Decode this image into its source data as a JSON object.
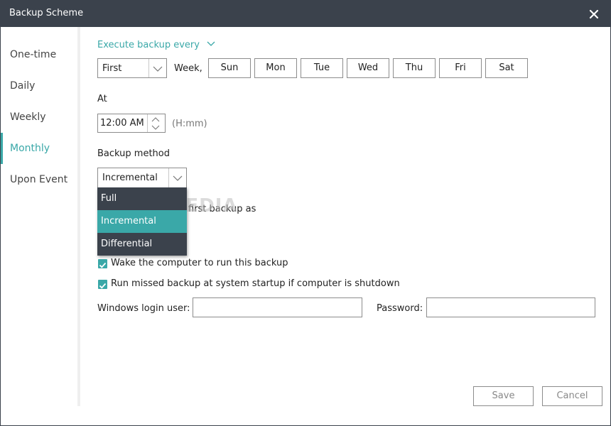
{
  "window": {
    "title": "Backup Scheme"
  },
  "sidebar": {
    "items": [
      {
        "label": "One-time"
      },
      {
        "label": "Daily"
      },
      {
        "label": "Weekly"
      },
      {
        "label": "Monthly"
      },
      {
        "label": "Upon Event"
      }
    ],
    "active": "Monthly"
  },
  "schedule": {
    "execute_label": "Execute backup every",
    "week_ordinal": "First",
    "week_label": "Week,",
    "days": [
      "Sun",
      "Mon",
      "Tue",
      "Wed",
      "Thu",
      "Fri",
      "Sat"
    ]
  },
  "time": {
    "at_label": "At",
    "value": "12:00 AM",
    "format_hint": "(H:mm)"
  },
  "method": {
    "label": "Backup method",
    "selected": "Incremental",
    "options": [
      "Full",
      "Incremental",
      "Differential"
    ],
    "partial_text": "first backup as"
  },
  "options": {
    "wake_label": "Wake the computer to run this backup",
    "wake_checked": true,
    "missed_label": "Run missed backup at system startup if computer is shutdown",
    "missed_checked": true
  },
  "login": {
    "user_label": "Windows login user:",
    "user_value": "",
    "password_label": "Password:",
    "password_value": ""
  },
  "buttons": {
    "save": "Save",
    "cancel": "Cancel"
  },
  "watermark": "SOFTPEDIA",
  "colors": {
    "accent": "#3aa8a8",
    "titlebar": "#3b424c",
    "dropdown": "#3b424c"
  },
  "icons": {
    "close": "close-icon",
    "dropdown_arrow": "chevron-down-icon",
    "spinner": "spinner-arrows-icon",
    "check": "check-icon"
  }
}
